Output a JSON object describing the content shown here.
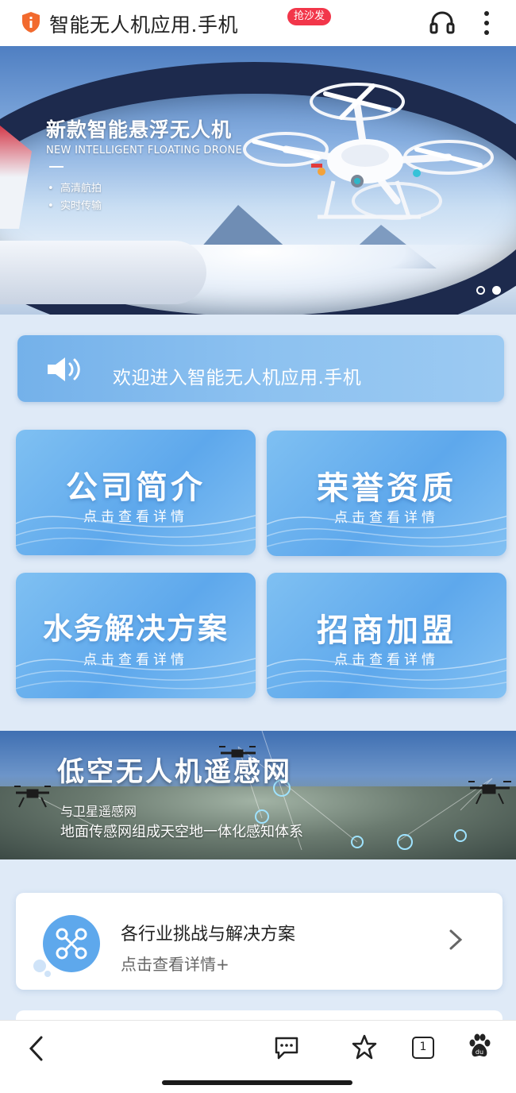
{
  "topbar": {
    "title": "智能无人机应用.手机",
    "shield_icon": "shield-info-icon",
    "headphone_icon": "headphone-icon",
    "more_icon": "more-vertical-icon"
  },
  "hero": {
    "title": "新款智能悬浮无人机",
    "subtitle": "NEW INTELLIGENT FLOATING DRONE",
    "bullets": [
      "高清航拍",
      "实时传输"
    ],
    "carousel_dots": 2,
    "active_dot": 1
  },
  "notice": {
    "text": "欢迎进入智能无人机应用.手机",
    "icon": "speaker-icon"
  },
  "tiles": [
    {
      "title": "公司简介",
      "subtitle": "点击查看详情"
    },
    {
      "title": "荣誉资质",
      "subtitle": "点击查看详情"
    },
    {
      "title": "水务解决方案",
      "subtitle": "点击查看详情"
    },
    {
      "title": "招商加盟",
      "subtitle": "点击查看详情"
    }
  ],
  "remote_sensing": {
    "title": "低空无人机遥感网",
    "line1": "与卫星遥感网",
    "line2": "地面传感网组成天空地一体化感知体系"
  },
  "solution": {
    "title": "各行业挑战与解决方案",
    "subtitle": "点击查看详情+",
    "icon": "drone-icon"
  },
  "bottom_nav": {
    "badge": "抢沙发",
    "tab_count": "1",
    "icons": [
      "back-icon",
      "comment-icon",
      "star-icon",
      "tabs-icon",
      "baidu-paw-icon"
    ]
  },
  "colors": {
    "accent": "#5ea8ec",
    "notice_bg": "#8cc1f0",
    "badge": "#f2364a",
    "shield": "#f26a2e"
  }
}
